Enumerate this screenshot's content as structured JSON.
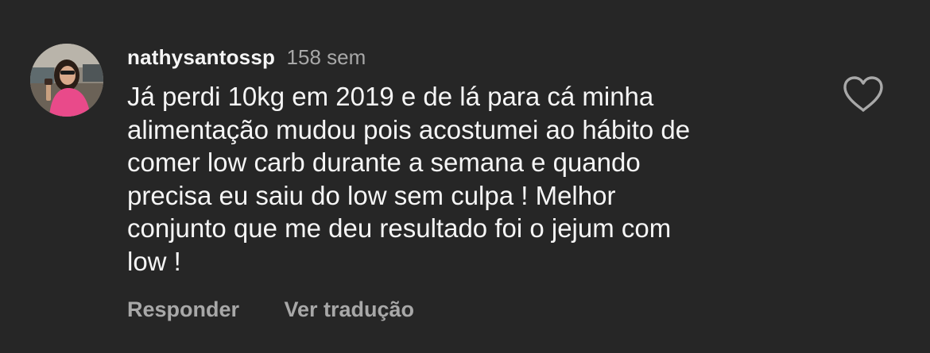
{
  "comment": {
    "username": "nathysantossp",
    "time": "158 sem",
    "text": "Já perdi 10kg em 2019 e de lá para cá minha\nalimentação mudou pois acostumei ao hábito de\ncomer low carb durante a semana e quando\nprecisa eu saiu do low sem culpa !  Melhor\nconjunto que me deu resultado foi o jejum com\nlow !",
    "actions": {
      "reply": "Responder",
      "translate": "Ver tradução"
    }
  },
  "icons": {
    "like": "heart-outline-icon",
    "avatar": "profile-photo"
  },
  "colors": {
    "background": "#262626",
    "primary_text": "#f5f5f5",
    "secondary_text": "#a8a8a8"
  }
}
